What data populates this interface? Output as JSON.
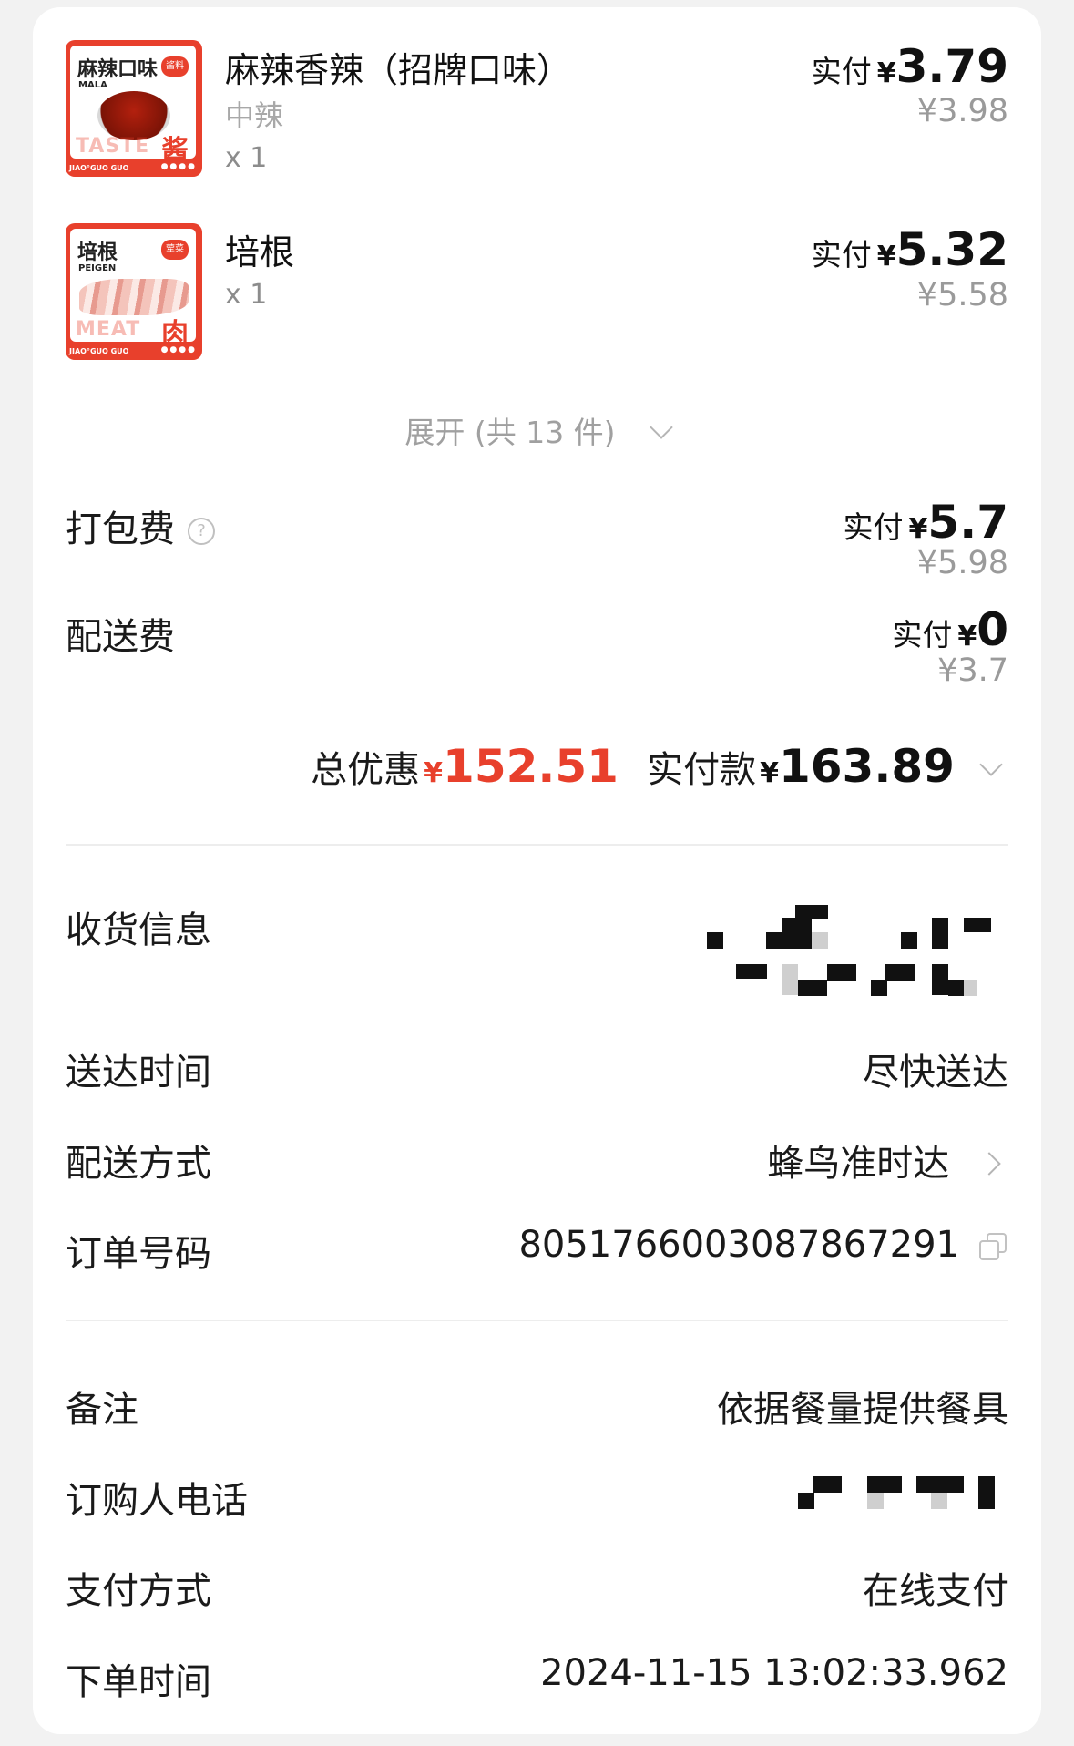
{
  "products": [
    {
      "name": "麻辣香辣（招牌口味）",
      "spec": "中辣",
      "qty": "x 1",
      "paid_label": "实付",
      "currency": "¥",
      "paid_amount": "3.79",
      "original_price": "¥3.98",
      "thumb": {
        "title": "麻辣口味",
        "subtitle": "MALA",
        "badge": "酱料",
        "big": "TASTE",
        "hanzi": "酱",
        "footer": "JIAO°GUO GUO",
        "dots": "●●●●"
      }
    },
    {
      "name": "培根",
      "spec": "",
      "qty": "x 1",
      "paid_label": "实付",
      "currency": "¥",
      "paid_amount": "5.32",
      "original_price": "¥5.58",
      "thumb": {
        "title": "培根",
        "subtitle": "PEIGEN",
        "badge": "荤菜",
        "big": "MEAT",
        "hanzi": "肉",
        "footer": "JIAO°GUO GUO",
        "dots": "●●●●"
      }
    }
  ],
  "expand": {
    "label": "展开 (共 13 件)"
  },
  "fees": [
    {
      "label": "打包费",
      "paid_label": "实付",
      "currency": "¥",
      "paid_amount": "5.7",
      "original_price": "¥5.98"
    },
    {
      "label": "配送费",
      "paid_label": "实付",
      "currency": "¥",
      "paid_amount": "0",
      "original_price": "¥3.7"
    }
  ],
  "summary": {
    "discount_label": "总优惠",
    "discount_currency": "¥",
    "discount_amount": "152.51",
    "paid_label": "实付款",
    "paid_currency": "¥",
    "paid_amount": "163.89"
  },
  "info": {
    "receiver_label": "收货信息",
    "delivery_time_label": "送达时间",
    "delivery_time_value": "尽快送达",
    "delivery_method_label": "配送方式",
    "delivery_method_value": "蜂鸟准时达",
    "order_no_label": "订单号码",
    "order_no_value": "8051766003087867291",
    "remark_label": "备注",
    "remark_value": "依据餐量提供餐具",
    "phone_label": "订购人电话",
    "payment_label": "支付方式",
    "payment_value": "在线支付",
    "order_time_label": "下单时间",
    "order_time_value": "2024-11-15 13:02:33.962"
  },
  "icons": {
    "help": "question-circle-icon",
    "chevron_down": "chevron-down-icon",
    "chevron_right": "chevron-right-icon",
    "copy": "copy-icon"
  },
  "colors": {
    "accent_red": "#e8402c",
    "muted": "#9a9a9a",
    "background": "#f2f2f2"
  }
}
